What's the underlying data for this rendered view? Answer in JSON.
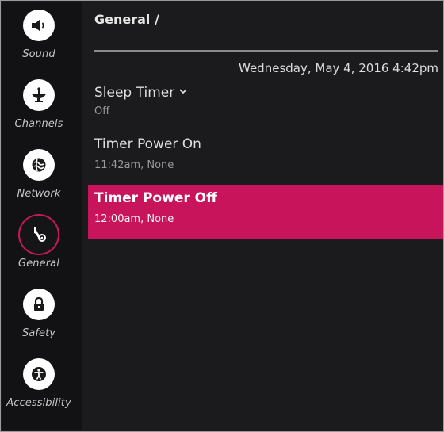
{
  "sidebar": {
    "items": [
      {
        "label": "Sound",
        "icon": "speaker-icon"
      },
      {
        "label": "Channels",
        "icon": "antenna-icon"
      },
      {
        "label": "Network",
        "icon": "globe-icon"
      },
      {
        "label": "General",
        "icon": "tools-icon",
        "active": true
      },
      {
        "label": "Safety",
        "icon": "lock-icon"
      },
      {
        "label": "Accessibility",
        "icon": "accessibility-icon"
      }
    ]
  },
  "header": {
    "breadcrumb": "General /",
    "datetime": "Wednesday, May 4, 2016 4:42pm"
  },
  "settings": [
    {
      "title": "Sleep Timer",
      "value": "Off",
      "expandable": true
    },
    {
      "title": "Timer Power On",
      "value": "11:42am, None"
    },
    {
      "title": "Timer Power Off",
      "value": "12:00am, None",
      "selected": true
    }
  ],
  "colors": {
    "accent": "#c8145b",
    "background": "#1b1b1d",
    "sidebar": "#121214"
  }
}
